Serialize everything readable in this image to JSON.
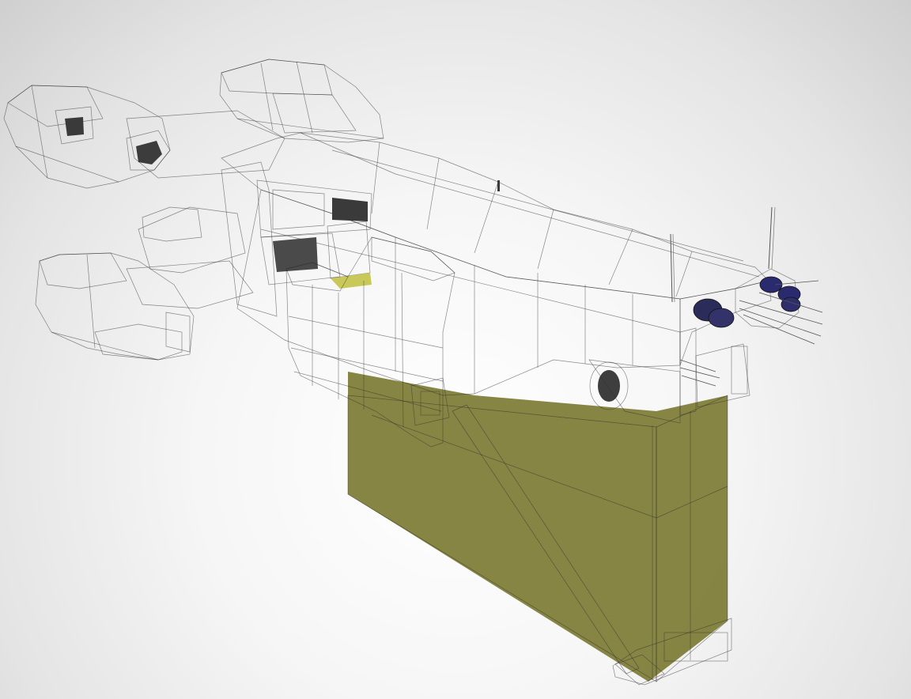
{
  "viewport": {
    "background": "#f2f2f2",
    "hull_color": "#9a9a9a",
    "hull_dark_color": "#5c5c5c",
    "hull_light_color": "#c4c4c4",
    "shield_color": "#556064",
    "hangar_color": "#8a8a3a",
    "hangar_light_color": "#dede6a",
    "engine_accent_color": "#2a2a6e"
  }
}
